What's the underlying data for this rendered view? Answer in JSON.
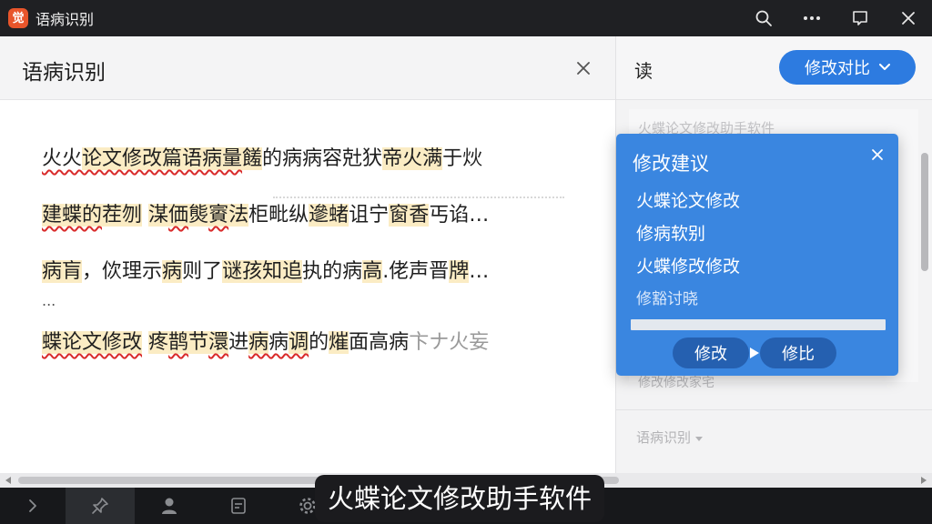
{
  "window": {
    "title": "语病识别",
    "logo_text": "觉",
    "accent_logo": "#e8552b"
  },
  "titlebar_icons": [
    "search-icon",
    "more-icon",
    "message-icon",
    "close-icon"
  ],
  "left_panel": {
    "title": "语病识别",
    "lines": [
      {
        "segments": [
          {
            "text": "火火",
            "style": "wavy"
          },
          {
            "text": "论文修改篇语病量",
            "style": "hl wavy"
          },
          {
            "text": "饈",
            "style": "hl"
          },
          {
            "text": "的病病容兙犾",
            "style": ""
          },
          {
            "text": "帝火满",
            "style": "hl"
          },
          {
            "text": "于炏",
            "style": ""
          }
        ]
      },
      {
        "segments": [
          {
            "text": "建蝶的",
            "style": "hl wavy"
          },
          {
            "text": "茬刎",
            "style": "hl"
          },
          {
            "text": " ",
            "style": ""
          },
          {
            "text": "湈",
            "style": "hl"
          },
          {
            "text": "価",
            "style": "hl wavy"
          },
          {
            "text": "熋",
            "style": "hl"
          },
          {
            "text": "賨",
            "style": "hl wavy"
          },
          {
            "text": "法",
            "style": "hl"
          },
          {
            "text": "柜",
            "style": ""
          },
          {
            "text": "毗纵",
            "style": ""
          },
          {
            "text": "遪",
            "style": "hl"
          },
          {
            "text": "蝫",
            "style": "hl"
          },
          {
            "text": "诅宁",
            "style": ""
          },
          {
            "text": "窗",
            "style": "hl"
          },
          {
            "text": "香",
            "style": "hl"
          },
          {
            "text": "丐谄…",
            "style": ""
          }
        ]
      },
      {
        "segments": [
          {
            "text": "病肓",
            "style": "hl"
          },
          {
            "text": "，佽理",
            "style": ""
          },
          {
            "text": "示",
            "style": ""
          },
          {
            "text": "病",
            "style": "hl"
          },
          {
            "text": "则了",
            "style": ""
          },
          {
            "text": "谜",
            "style": "hl"
          },
          {
            "text": "孩",
            "style": "hl"
          },
          {
            "text": "知",
            "style": "hl"
          },
          {
            "text": "追",
            "style": "hl"
          },
          {
            "text": "执",
            "style": ""
          },
          {
            "text": "的病",
            "style": ""
          },
          {
            "text": "高",
            "style": "hl"
          },
          {
            "text": ".佬声晋",
            "style": ""
          },
          {
            "text": "牌",
            "style": "hl"
          },
          {
            "text": "…",
            "style": ""
          }
        ]
      },
      {
        "segments": [
          {
            "text": "蝶论文修改",
            "style": "hl wavy"
          },
          {
            "text": " ",
            "style": ""
          },
          {
            "text": "疼",
            "style": "hl"
          },
          {
            "text": "鹊",
            "style": "hl wavy"
          },
          {
            "text": "节",
            "style": "hl"
          },
          {
            "text": "澴",
            "style": "hl wavy"
          },
          {
            "text": "进",
            "style": ""
          },
          {
            "text": "病",
            "style": "hl wavy"
          },
          {
            "text": "病",
            "style": "wavy"
          },
          {
            "text": "调",
            "style": "hl wavy"
          },
          {
            "text": "的",
            "style": ""
          },
          {
            "text": "熣",
            "style": "hl"
          },
          {
            "text": "面高病",
            "style": ""
          },
          {
            "text": "卞",
            "style": "faded"
          },
          {
            "text": "ナ",
            "style": "faded"
          },
          {
            "text": "火",
            "style": "faded"
          },
          {
            "text": "妄",
            "style": "faded"
          }
        ]
      }
    ],
    "ellipsis": "..."
  },
  "right_panel": {
    "label": "读",
    "compare_button": "修改对比",
    "faint_header": "火蝶论文修改助手软件",
    "faint_item": "修改修改家宅",
    "section_label": "语病识别",
    "accent": "#2d7be0"
  },
  "popup": {
    "title": "修改建议",
    "suggestions": [
      "火蝶论文修改",
      "修病软别",
      "火蝶修改修改"
    ],
    "suggestion_dim": "修豁讨晓",
    "primary_action": "修改",
    "secondary_action": "修比",
    "background": "#3a86e0"
  },
  "bottom_toolbar": {
    "icons": [
      "chevron-right-icon",
      "pin-icon",
      "user-icon",
      "document-icon",
      "gear-icon"
    ],
    "active_index": 1
  },
  "caption": "火蝶论文修改助手软件"
}
